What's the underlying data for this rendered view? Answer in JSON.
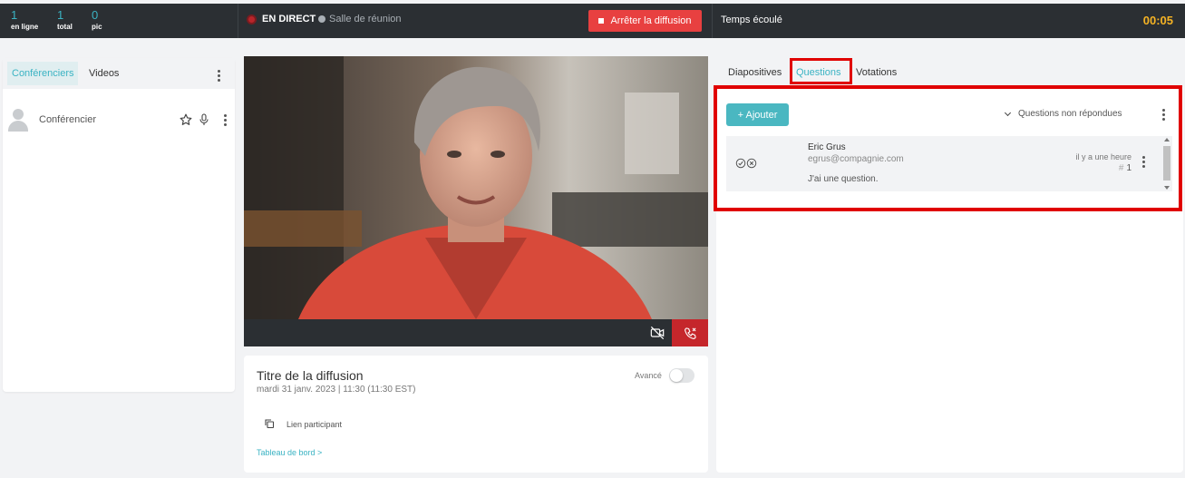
{
  "topbar": {
    "stats": [
      {
        "value": "1",
        "label": "en ligne"
      },
      {
        "value": "1",
        "label": "total"
      },
      {
        "value": "0",
        "label": "pic"
      }
    ],
    "live_label": "EN DIRECT",
    "room_label": "Salle de réunion",
    "stop_button_label": "Arrêter la diffusion",
    "elapsed_label": "Temps écoulé",
    "elapsed_time": "00:05"
  },
  "left_panel": {
    "tabs": [
      {
        "label": "Conférenciers",
        "active": true
      },
      {
        "label": "Videos",
        "active": false
      }
    ],
    "speakers": [
      {
        "name": "Conférencier"
      }
    ]
  },
  "broadcast": {
    "title": "Titre de la diffusion",
    "datetime": "mardi 31 janv. 2023 | 11:30 (11:30 EST)",
    "advanced_label": "Avancé",
    "advanced_enabled": false,
    "participant_link_label": "Lien participant",
    "dashboard_link_label": "Tableau de bord >"
  },
  "right_panel": {
    "tabs": [
      {
        "label": "Diapositives",
        "active": false
      },
      {
        "label": "Questions",
        "active": true
      },
      {
        "label": "Votations",
        "active": false
      }
    ],
    "add_button_label": "+ Ajouter",
    "filter_label": "Questions non répondues",
    "questions": [
      {
        "author": "Eric Grus",
        "email": "egrus@compagnie.com",
        "text": "J'ai une question.",
        "time": "il y a une heure",
        "number": "1"
      }
    ]
  },
  "colors": {
    "accent": "#3ab3c3",
    "topbar_bg": "#2b2f33",
    "stop_button": "#e84040",
    "end_call": "#c5262b",
    "timer": "#f5b324",
    "highlight": "#e00000"
  }
}
